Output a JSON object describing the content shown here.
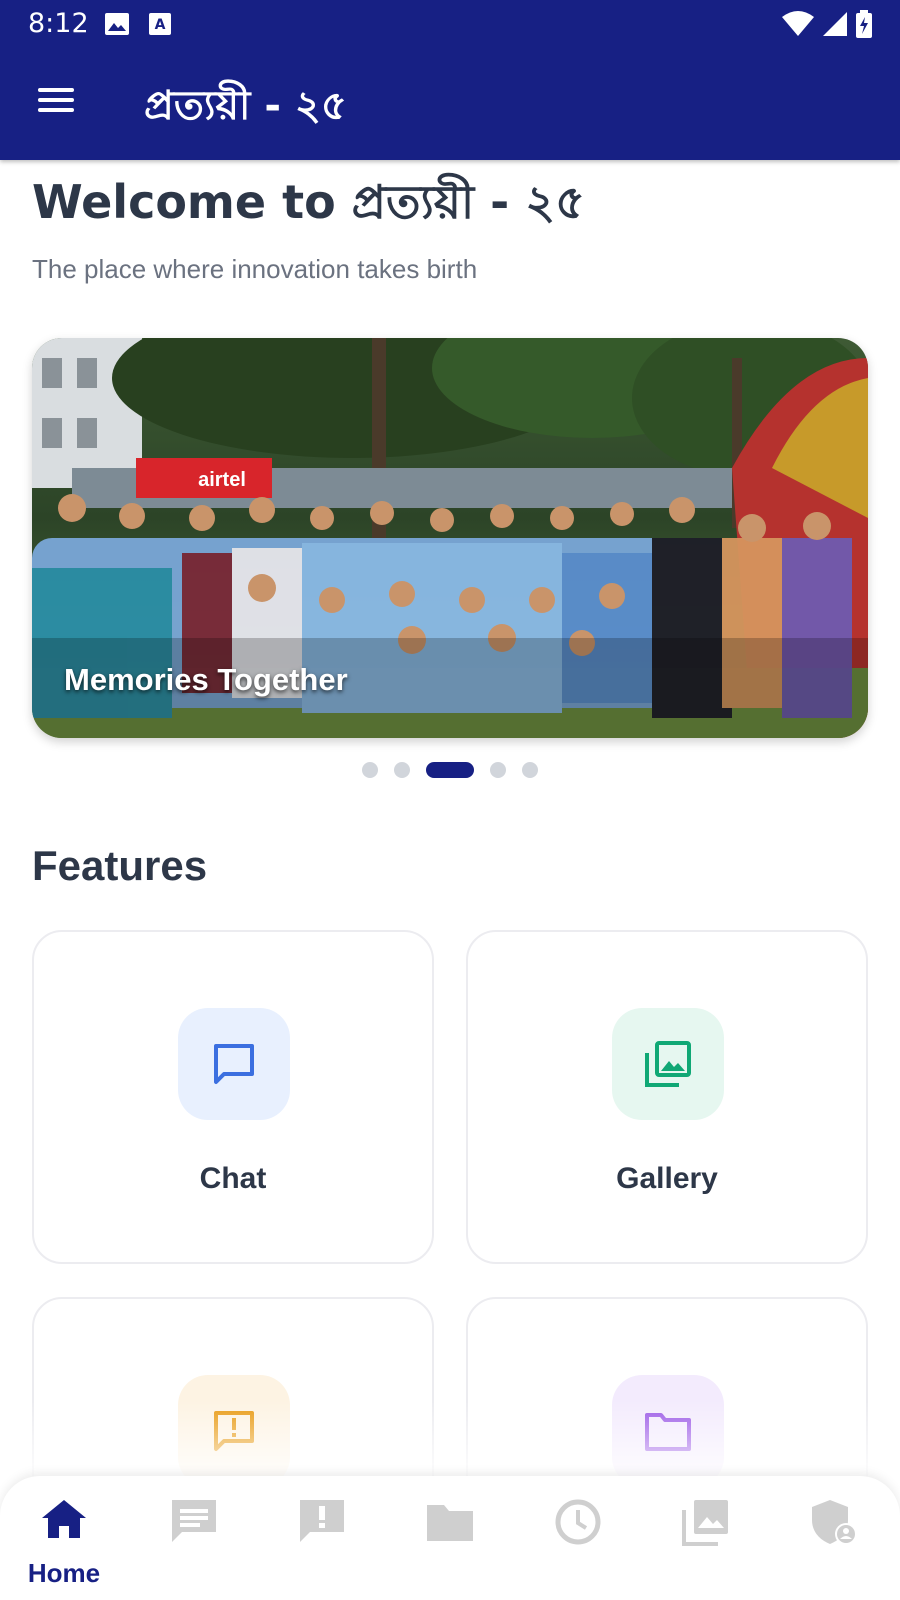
{
  "status_bar": {
    "time": "8:12"
  },
  "app_bar": {
    "title": "প্রত্যয়ী - ২৫"
  },
  "welcome": {
    "title": "Welcome to প্রত্যয়ী - ২৫",
    "subtitle": "The place where innovation takes birth"
  },
  "carousel": {
    "caption": "Memories Together",
    "slide_count": 5,
    "active_index": 2
  },
  "features": {
    "title": "Features",
    "cards": [
      {
        "label": "Chat",
        "icon": "chat-icon",
        "color": "#3b6fe0",
        "bg": "#e8f0fe"
      },
      {
        "label": "Gallery",
        "icon": "gallery-icon",
        "color": "#10a875",
        "bg": "#e6f7f0"
      },
      {
        "label": "",
        "icon": "report-icon",
        "color": "#e89a13",
        "bg": "#fdf3e3"
      },
      {
        "label": "",
        "icon": "folder-icon",
        "color": "#9b59e6",
        "bg": "#f3ebfd"
      }
    ]
  },
  "bottom_nav": {
    "items": [
      {
        "label": "Home",
        "icon": "home-icon",
        "active": true
      },
      {
        "label": "",
        "icon": "chat-icon",
        "active": false
      },
      {
        "label": "",
        "icon": "report-icon",
        "active": false
      },
      {
        "label": "",
        "icon": "folder-icon",
        "active": false
      },
      {
        "label": "",
        "icon": "clock-icon",
        "active": false
      },
      {
        "label": "",
        "icon": "gallery-icon",
        "active": false
      },
      {
        "label": "",
        "icon": "admin-shield-icon",
        "active": false
      }
    ]
  },
  "colors": {
    "primary": "#172084",
    "text_dark": "#2d3748",
    "text_muted": "#6b7280",
    "nav_inactive": "#cfcfcf"
  }
}
